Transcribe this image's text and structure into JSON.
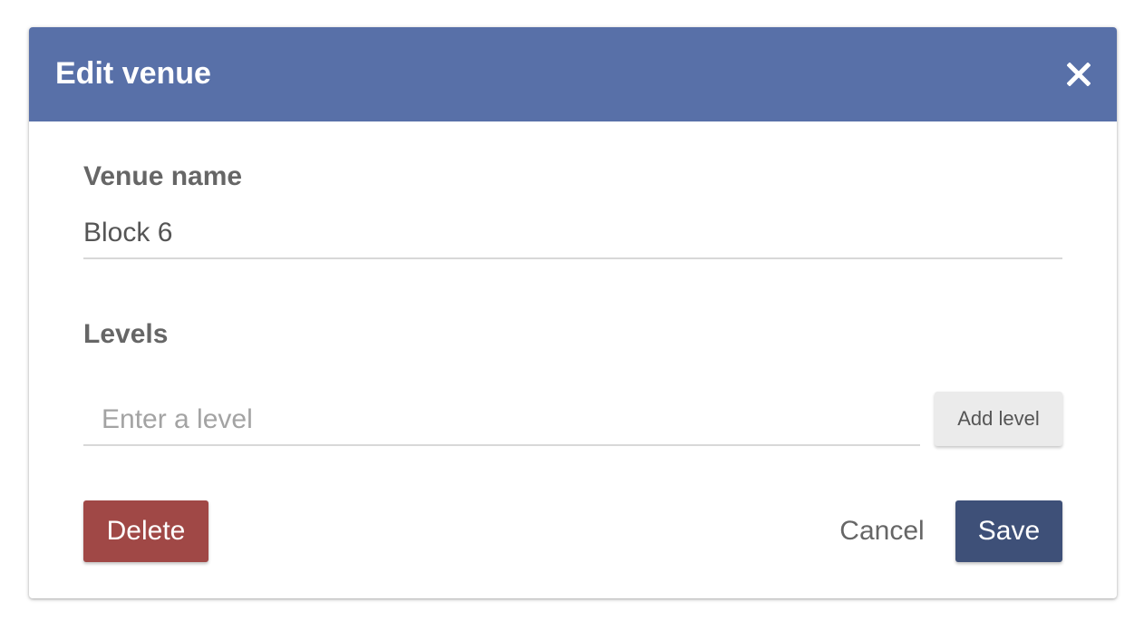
{
  "dialog": {
    "title": "Edit venue",
    "close_icon": "close-icon",
    "header_color": "#5870a8"
  },
  "venue_name": {
    "label": "Venue name",
    "value": "Block 6"
  },
  "levels": {
    "label": "Levels",
    "input_value": "",
    "input_placeholder": "Enter a level",
    "add_button_label": "Add level"
  },
  "footer": {
    "delete_label": "Delete",
    "cancel_label": "Cancel",
    "save_label": "Save",
    "delete_color": "#a04846",
    "save_color": "#3e5078"
  }
}
